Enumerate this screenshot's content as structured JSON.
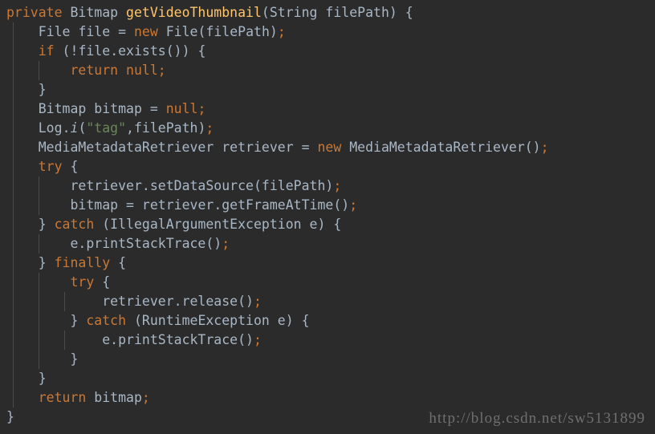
{
  "editor": {
    "background_color": "#2b2b2b",
    "indent_guide_color": "#4b4b4b",
    "language": "java",
    "theme": "darcula",
    "font_size_px": 16.5,
    "line_height_px": 24,
    "colors": {
      "keyword": "#cc7832",
      "identifier": "#a9b7c6",
      "method": "#ffc66d",
      "string": "#6a8759",
      "semicolon": "#cc7832",
      "background": "#2b2b2b",
      "watermark": "#6f6f6f"
    },
    "indent_guides_x": [
      16,
      48,
      80,
      112
    ],
    "lines": [
      {
        "index": 1,
        "indent": 0,
        "text": "private Bitmap getVideoThumbnail(String filePath) {",
        "tokens": [
          {
            "t": "private",
            "c": "kw"
          },
          {
            "t": " ",
            "c": "punc"
          },
          {
            "t": "Bitmap",
            "c": "type"
          },
          {
            "t": " ",
            "c": "punc"
          },
          {
            "t": "getVideoThumbnail",
            "c": "mth"
          },
          {
            "t": "(",
            "c": "punc"
          },
          {
            "t": "String",
            "c": "type"
          },
          {
            "t": " ",
            "c": "punc"
          },
          {
            "t": "filePath",
            "c": "id"
          },
          {
            "t": ")",
            "c": "punc"
          },
          {
            "t": " ",
            "c": "punc"
          },
          {
            "t": "{",
            "c": "brace"
          }
        ]
      },
      {
        "index": 2,
        "indent": 1,
        "text": "    File file = new File(filePath);",
        "tokens": [
          {
            "t": "    ",
            "c": "punc"
          },
          {
            "t": "File",
            "c": "type"
          },
          {
            "t": " ",
            "c": "punc"
          },
          {
            "t": "file",
            "c": "id"
          },
          {
            "t": " = ",
            "c": "punc"
          },
          {
            "t": "new",
            "c": "kw"
          },
          {
            "t": " ",
            "c": "punc"
          },
          {
            "t": "File",
            "c": "type"
          },
          {
            "t": "(",
            "c": "punc"
          },
          {
            "t": "filePath",
            "c": "id"
          },
          {
            "t": ")",
            "c": "punc"
          },
          {
            "t": ";",
            "c": "semi"
          }
        ]
      },
      {
        "index": 3,
        "indent": 1,
        "text": "    if (!file.exists()) {",
        "tokens": [
          {
            "t": "    ",
            "c": "punc"
          },
          {
            "t": "if",
            "c": "kw"
          },
          {
            "t": " (",
            "c": "punc"
          },
          {
            "t": "!",
            "c": "punc"
          },
          {
            "t": "file",
            "c": "id"
          },
          {
            "t": ".",
            "c": "punc"
          },
          {
            "t": "exists",
            "c": "id"
          },
          {
            "t": "())",
            "c": "punc"
          },
          {
            "t": " ",
            "c": "punc"
          },
          {
            "t": "{",
            "c": "brace"
          }
        ]
      },
      {
        "index": 4,
        "indent": 2,
        "text": "        return null;",
        "tokens": [
          {
            "t": "        ",
            "c": "punc"
          },
          {
            "t": "return",
            "c": "kw"
          },
          {
            "t": " ",
            "c": "punc"
          },
          {
            "t": "null",
            "c": "kw"
          },
          {
            "t": ";",
            "c": "semi"
          }
        ]
      },
      {
        "index": 5,
        "indent": 1,
        "text": "    }",
        "tokens": [
          {
            "t": "    ",
            "c": "punc"
          },
          {
            "t": "}",
            "c": "brace"
          }
        ]
      },
      {
        "index": 6,
        "indent": 1,
        "text": "    Bitmap bitmap = null;",
        "tokens": [
          {
            "t": "    ",
            "c": "punc"
          },
          {
            "t": "Bitmap",
            "c": "type"
          },
          {
            "t": " ",
            "c": "punc"
          },
          {
            "t": "bitmap",
            "c": "id"
          },
          {
            "t": " = ",
            "c": "punc"
          },
          {
            "t": "null",
            "c": "kw"
          },
          {
            "t": ";",
            "c": "semi"
          }
        ]
      },
      {
        "index": 7,
        "indent": 1,
        "text": "    Log.i(\"tag\",filePath);",
        "tokens": [
          {
            "t": "    ",
            "c": "punc"
          },
          {
            "t": "Log",
            "c": "id"
          },
          {
            "t": ".",
            "c": "punc"
          },
          {
            "t": "i",
            "c": "it"
          },
          {
            "t": "(",
            "c": "punc"
          },
          {
            "t": "\"tag\"",
            "c": "str"
          },
          {
            "t": ",",
            "c": "punc"
          },
          {
            "t": "filePath",
            "c": "id"
          },
          {
            "t": ")",
            "c": "punc"
          },
          {
            "t": ";",
            "c": "semi"
          }
        ]
      },
      {
        "index": 8,
        "indent": 1,
        "text": "    MediaMetadataRetriever retriever = new MediaMetadataRetriever();",
        "tokens": [
          {
            "t": "    ",
            "c": "punc"
          },
          {
            "t": "MediaMetadataRetriever",
            "c": "type"
          },
          {
            "t": " ",
            "c": "punc"
          },
          {
            "t": "retriever",
            "c": "id"
          },
          {
            "t": " = ",
            "c": "punc"
          },
          {
            "t": "new",
            "c": "kw"
          },
          {
            "t": " ",
            "c": "punc"
          },
          {
            "t": "MediaMetadataRetriever",
            "c": "type"
          },
          {
            "t": "()",
            "c": "punc"
          },
          {
            "t": ";",
            "c": "semi"
          }
        ]
      },
      {
        "index": 9,
        "indent": 1,
        "text": "    try {",
        "tokens": [
          {
            "t": "    ",
            "c": "punc"
          },
          {
            "t": "try",
            "c": "kw"
          },
          {
            "t": " ",
            "c": "punc"
          },
          {
            "t": "{",
            "c": "brace"
          }
        ]
      },
      {
        "index": 10,
        "indent": 2,
        "text": "        retriever.setDataSource(filePath);",
        "tokens": [
          {
            "t": "        ",
            "c": "punc"
          },
          {
            "t": "retriever",
            "c": "id"
          },
          {
            "t": ".",
            "c": "punc"
          },
          {
            "t": "setDataSource",
            "c": "id"
          },
          {
            "t": "(",
            "c": "punc"
          },
          {
            "t": "filePath",
            "c": "id"
          },
          {
            "t": ")",
            "c": "punc"
          },
          {
            "t": ";",
            "c": "semi"
          }
        ]
      },
      {
        "index": 11,
        "indent": 2,
        "text": "        bitmap = retriever.getFrameAtTime();",
        "tokens": [
          {
            "t": "        ",
            "c": "punc"
          },
          {
            "t": "bitmap",
            "c": "id"
          },
          {
            "t": " = ",
            "c": "punc"
          },
          {
            "t": "retriever",
            "c": "id"
          },
          {
            "t": ".",
            "c": "punc"
          },
          {
            "t": "getFrameAtTime",
            "c": "id"
          },
          {
            "t": "()",
            "c": "punc"
          },
          {
            "t": ";",
            "c": "semi"
          }
        ]
      },
      {
        "index": 12,
        "indent": 1,
        "text": "    } catch (IllegalArgumentException e) {",
        "tokens": [
          {
            "t": "    ",
            "c": "punc"
          },
          {
            "t": "}",
            "c": "brace"
          },
          {
            "t": " ",
            "c": "punc"
          },
          {
            "t": "catch",
            "c": "kw"
          },
          {
            "t": " (",
            "c": "punc"
          },
          {
            "t": "IllegalArgumentException",
            "c": "type"
          },
          {
            "t": " ",
            "c": "punc"
          },
          {
            "t": "e",
            "c": "id"
          },
          {
            "t": ")",
            "c": "punc"
          },
          {
            "t": " ",
            "c": "punc"
          },
          {
            "t": "{",
            "c": "brace"
          }
        ]
      },
      {
        "index": 13,
        "indent": 2,
        "text": "        e.printStackTrace();",
        "tokens": [
          {
            "t": "        ",
            "c": "punc"
          },
          {
            "t": "e",
            "c": "id"
          },
          {
            "t": ".",
            "c": "punc"
          },
          {
            "t": "printStackTrace",
            "c": "id"
          },
          {
            "t": "()",
            "c": "punc"
          },
          {
            "t": ";",
            "c": "semi"
          }
        ]
      },
      {
        "index": 14,
        "indent": 1,
        "text": "    } finally {",
        "tokens": [
          {
            "t": "    ",
            "c": "punc"
          },
          {
            "t": "}",
            "c": "brace"
          },
          {
            "t": " ",
            "c": "punc"
          },
          {
            "t": "finally",
            "c": "kw"
          },
          {
            "t": " ",
            "c": "punc"
          },
          {
            "t": "{",
            "c": "brace"
          }
        ]
      },
      {
        "index": 15,
        "indent": 2,
        "text": "        try {",
        "tokens": [
          {
            "t": "        ",
            "c": "punc"
          },
          {
            "t": "try",
            "c": "kw"
          },
          {
            "t": " ",
            "c": "punc"
          },
          {
            "t": "{",
            "c": "brace"
          }
        ]
      },
      {
        "index": 16,
        "indent": 3,
        "text": "            retriever.release();",
        "tokens": [
          {
            "t": "            ",
            "c": "punc"
          },
          {
            "t": "retriever",
            "c": "id"
          },
          {
            "t": ".",
            "c": "punc"
          },
          {
            "t": "release",
            "c": "id"
          },
          {
            "t": "()",
            "c": "punc"
          },
          {
            "t": ";",
            "c": "semi"
          }
        ]
      },
      {
        "index": 17,
        "indent": 2,
        "text": "        } catch (RuntimeException e) {",
        "tokens": [
          {
            "t": "        ",
            "c": "punc"
          },
          {
            "t": "}",
            "c": "brace"
          },
          {
            "t": " ",
            "c": "punc"
          },
          {
            "t": "catch",
            "c": "kw"
          },
          {
            "t": " (",
            "c": "punc"
          },
          {
            "t": "RuntimeException",
            "c": "type"
          },
          {
            "t": " ",
            "c": "punc"
          },
          {
            "t": "e",
            "c": "id"
          },
          {
            "t": ")",
            "c": "punc"
          },
          {
            "t": " ",
            "c": "punc"
          },
          {
            "t": "{",
            "c": "brace"
          }
        ]
      },
      {
        "index": 18,
        "indent": 3,
        "text": "            e.printStackTrace();",
        "tokens": [
          {
            "t": "            ",
            "c": "punc"
          },
          {
            "t": "e",
            "c": "id"
          },
          {
            "t": ".",
            "c": "punc"
          },
          {
            "t": "printStackTrace",
            "c": "id"
          },
          {
            "t": "()",
            "c": "punc"
          },
          {
            "t": ";",
            "c": "semi"
          }
        ]
      },
      {
        "index": 19,
        "indent": 2,
        "text": "        }",
        "tokens": [
          {
            "t": "        ",
            "c": "punc"
          },
          {
            "t": "}",
            "c": "brace"
          }
        ]
      },
      {
        "index": 20,
        "indent": 1,
        "text": "    }",
        "tokens": [
          {
            "t": "    ",
            "c": "punc"
          },
          {
            "t": "}",
            "c": "brace"
          }
        ]
      },
      {
        "index": 21,
        "indent": 1,
        "text": "    return bitmap;",
        "tokens": [
          {
            "t": "    ",
            "c": "punc"
          },
          {
            "t": "return",
            "c": "kw"
          },
          {
            "t": " ",
            "c": "punc"
          },
          {
            "t": "bitmap",
            "c": "id"
          },
          {
            "t": ";",
            "c": "semi"
          }
        ]
      },
      {
        "index": 22,
        "indent": 0,
        "text": "}",
        "tokens": [
          {
            "t": "}",
            "c": "brace"
          }
        ]
      }
    ]
  },
  "watermark": {
    "text": "http://blog.csdn.net/sw5131899"
  }
}
